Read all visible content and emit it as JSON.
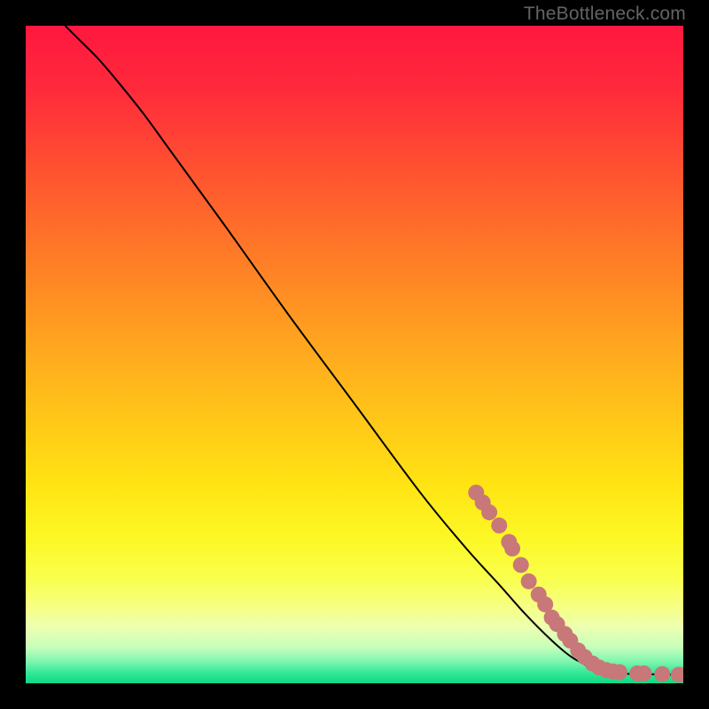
{
  "watermark": "TheBottleneck.com",
  "chart_data": {
    "type": "line",
    "title": "",
    "xlabel": "",
    "ylabel": "",
    "xlim": [
      0,
      100
    ],
    "ylim": [
      0,
      100
    ],
    "grid": false,
    "series": [
      {
        "name": "curve",
        "type": "line",
        "color": "#000000",
        "points": [
          {
            "x": 6,
            "y": 100
          },
          {
            "x": 8,
            "y": 98
          },
          {
            "x": 11,
            "y": 95
          },
          {
            "x": 14,
            "y": 91.5
          },
          {
            "x": 18,
            "y": 86.5
          },
          {
            "x": 22,
            "y": 81
          },
          {
            "x": 30,
            "y": 70
          },
          {
            "x": 40,
            "y": 56
          },
          {
            "x": 50,
            "y": 42.5
          },
          {
            "x": 60,
            "y": 29
          },
          {
            "x": 67,
            "y": 20.5
          },
          {
            "x": 72,
            "y": 15
          },
          {
            "x": 76,
            "y": 10.5
          },
          {
            "x": 80,
            "y": 6.5
          },
          {
            "x": 83,
            "y": 4
          },
          {
            "x": 86,
            "y": 2.4
          },
          {
            "x": 88,
            "y": 1.8
          },
          {
            "x": 90,
            "y": 1.5
          },
          {
            "x": 94,
            "y": 1.4
          },
          {
            "x": 100,
            "y": 1.3
          }
        ]
      },
      {
        "name": "markers",
        "type": "scatter",
        "color": "#c87878",
        "radius": 9,
        "points": [
          {
            "x": 68.5,
            "y": 29
          },
          {
            "x": 69.5,
            "y": 27.5
          },
          {
            "x": 70.5,
            "y": 26
          },
          {
            "x": 72,
            "y": 24
          },
          {
            "x": 73.5,
            "y": 21.5
          },
          {
            "x": 74,
            "y": 20.5
          },
          {
            "x": 75.3,
            "y": 18
          },
          {
            "x": 76.5,
            "y": 15.5
          },
          {
            "x": 78,
            "y": 13.5
          },
          {
            "x": 79,
            "y": 12
          },
          {
            "x": 80,
            "y": 10
          },
          {
            "x": 80.8,
            "y": 9
          },
          {
            "x": 82,
            "y": 7.5
          },
          {
            "x": 82.8,
            "y": 6.5
          },
          {
            "x": 84,
            "y": 5
          },
          {
            "x": 85,
            "y": 4
          },
          {
            "x": 86.2,
            "y": 3
          },
          {
            "x": 87.2,
            "y": 2.4
          },
          {
            "x": 88.3,
            "y": 2
          },
          {
            "x": 89.3,
            "y": 1.8
          },
          {
            "x": 90.3,
            "y": 1.7
          },
          {
            "x": 93,
            "y": 1.5
          },
          {
            "x": 94,
            "y": 1.5
          },
          {
            "x": 96.8,
            "y": 1.4
          },
          {
            "x": 99.3,
            "y": 1.3
          },
          {
            "x": 100.3,
            "y": 1.3
          }
        ]
      }
    ],
    "background_gradient": {
      "type": "vertical",
      "stops": [
        {
          "offset": 0.0,
          "color": "#ff173f"
        },
        {
          "offset": 0.1,
          "color": "#ff2b3b"
        },
        {
          "offset": 0.22,
          "color": "#ff5230"
        },
        {
          "offset": 0.35,
          "color": "#ff7b27"
        },
        {
          "offset": 0.48,
          "color": "#ffa41f"
        },
        {
          "offset": 0.6,
          "color": "#ffc718"
        },
        {
          "offset": 0.7,
          "color": "#ffe413"
        },
        {
          "offset": 0.78,
          "color": "#fcf826"
        },
        {
          "offset": 0.84,
          "color": "#f9ff4b"
        },
        {
          "offset": 0.885,
          "color": "#f6ff85"
        },
        {
          "offset": 0.915,
          "color": "#ecffb0"
        },
        {
          "offset": 0.945,
          "color": "#c7ffbb"
        },
        {
          "offset": 0.965,
          "color": "#85f7b1"
        },
        {
          "offset": 0.985,
          "color": "#30e898"
        },
        {
          "offset": 1.0,
          "color": "#0fd884"
        }
      ]
    }
  }
}
